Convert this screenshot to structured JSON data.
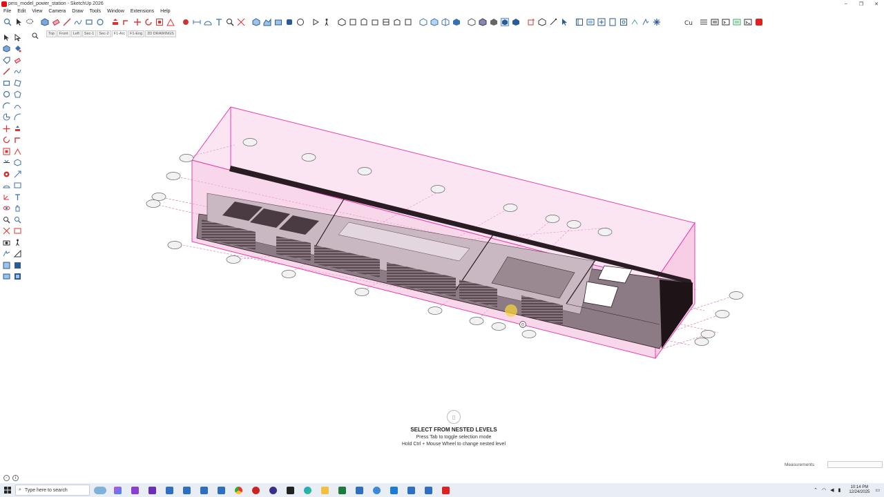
{
  "window": {
    "title": "pms_model_power_station - SketchUp 2026",
    "controls": [
      "–",
      "❐",
      "✕"
    ]
  },
  "menu": [
    "File",
    "Edit",
    "View",
    "Camera",
    "Draw",
    "Tools",
    "Window",
    "Extensions",
    "Help"
  ],
  "scenes": {
    "tabs": [
      "Top",
      "Front",
      "Left",
      "Sec-1",
      "Sec-2",
      "F1-Arc",
      "F1-Eng",
      "2D DRAWINGS"
    ],
    "active": "F1-Arc"
  },
  "viewport": {
    "selection_color": "#e83fae",
    "cursor_label": "0"
  },
  "hint": {
    "title": "SELECT FROM NESTED LEVELS",
    "line1": "Press Tab to toggle selection mode",
    "line2": "Hold Ctrl + Mouse Wheel to change nested level"
  },
  "status": {
    "measurements_label": "Measurements",
    "measurements_value": ""
  },
  "taskbar": {
    "search_placeholder": "Type here to search",
    "time": "10:14 PM",
    "date": "12/24/2025"
  },
  "colors": {
    "accent": "#e83fae",
    "taskbar": "#e9eef5"
  }
}
